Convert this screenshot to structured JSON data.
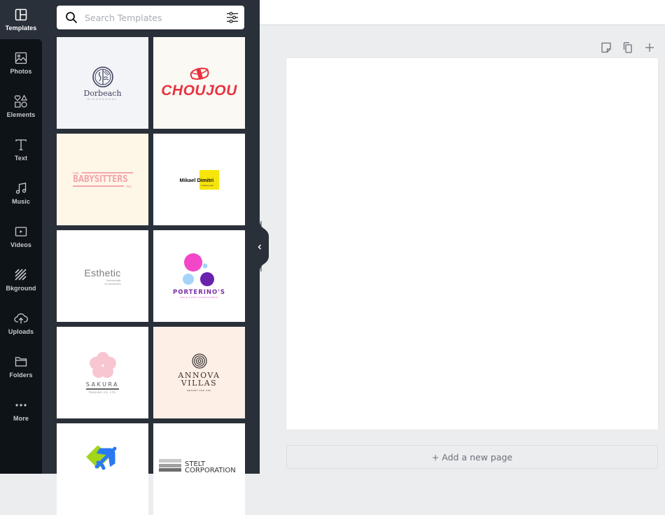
{
  "sidebar": {
    "items": [
      {
        "label": "Templates",
        "icon": "templates-icon",
        "active": true
      },
      {
        "label": "Photos",
        "icon": "photos-icon"
      },
      {
        "label": "Elements",
        "icon": "elements-icon"
      },
      {
        "label": "Text",
        "icon": "text-icon"
      },
      {
        "label": "Music",
        "icon": "music-icon"
      },
      {
        "label": "Videos",
        "icon": "videos-icon"
      },
      {
        "label": "Bkground",
        "icon": "background-icon"
      },
      {
        "label": "Uploads",
        "icon": "uploads-icon"
      },
      {
        "label": "Folders",
        "icon": "folders-icon"
      },
      {
        "label": "More",
        "icon": "more-icon"
      }
    ]
  },
  "search": {
    "placeholder": "Search Templates",
    "value": ""
  },
  "templates": [
    {
      "name": "Dorbeach",
      "subtitle": "HIGHSCHOOL",
      "bg": "#f3f4f8",
      "color": "#3c3f5c"
    },
    {
      "name": "CHOUJOU",
      "bg": "#fbf9f4",
      "color": "#e8323e"
    },
    {
      "name": "BABYSITTERS",
      "prefix": "THE",
      "suffix": "INC.",
      "bg": "#fef7e7",
      "color": "#f4a7b0"
    },
    {
      "name": "Mikael Dimitri",
      "subtitle": "Freelance Artist",
      "bg": "#ffffff",
      "color": "#111111",
      "accent": "#f5e50a"
    },
    {
      "name": "Esthetic",
      "subtitle1": "Dermatologie",
      "subtitle2": "de laboratoires",
      "bg": "#ffffff",
      "color": "#7d7d7d"
    },
    {
      "name": "PORTERINO'S",
      "subtitle": "DANCE & PARTY ENTERTAINMENT",
      "bg": "#ffffff",
      "color": "#7b2fa7",
      "accent": "#f347c9",
      "accent2": "#a5d4fa",
      "accent3": "#6a22ae"
    },
    {
      "name": "SAKURA",
      "subtitle": "TRADING CO. LTD.",
      "bg": "#ffffff",
      "color": "#555555",
      "accent": "#f8c6d1"
    },
    {
      "name": "ANNOVA",
      "name2": "VILLAS",
      "subtitle": "RESORT AND SPA",
      "bg": "#fdeee6",
      "color": "#3a3330"
    },
    {
      "name": "",
      "bg": "#ffffff",
      "accent": "#a2d51b",
      "accent2": "#2a79f4"
    },
    {
      "name": "STELT",
      "name2": "CORPORATION",
      "bg": "#ffffff",
      "color": "#333333"
    }
  ],
  "canvas": {
    "tools": [
      "add-note-icon",
      "duplicate-page-icon",
      "add-page-icon"
    ],
    "add_page_label": "+ Add a new page"
  }
}
